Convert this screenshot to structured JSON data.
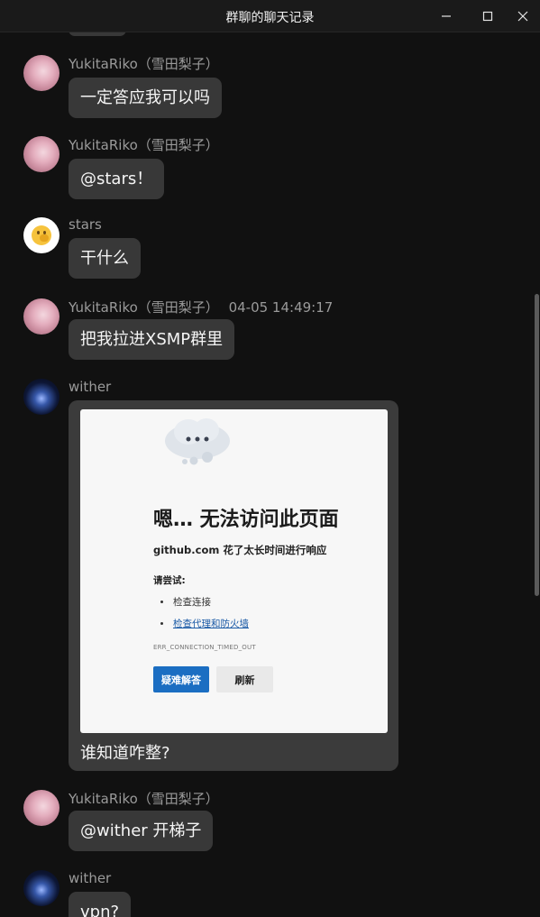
{
  "window": {
    "title": "群聊的聊天记录"
  },
  "messages": [
    {
      "sender": "YukitaRiko（雪田梨子）",
      "text": "一定答应我可以吗",
      "avatar_icon": "anime-girl-avatar"
    },
    {
      "sender": "YukitaRiko（雪田梨子）",
      "text": "@stars！",
      "avatar_icon": "anime-girl-avatar"
    },
    {
      "sender": "stars",
      "text": "干什么",
      "avatar_icon": "thinking-face-emoji"
    },
    {
      "sender": "YukitaRiko（雪田梨子）",
      "time": "04-05 14:49:17",
      "text": "把我拉进XSMP群里",
      "avatar_icon": "anime-girl-avatar"
    },
    {
      "sender": "wither",
      "text": "谁知道咋整?",
      "avatar_icon": "night-sky-avatar"
    },
    {
      "sender": "YukitaRiko（雪田梨子）",
      "text": "@wither 开梯子",
      "avatar_icon": "anime-girl-avatar"
    },
    {
      "sender": "wither",
      "text": "vpn?",
      "avatar_icon": "night-sky-avatar"
    }
  ],
  "error_page": {
    "heading": "嗯… 无法访问此页面",
    "subtitle": "github.com 花了太长时间进行响应",
    "try_label": "请尝试:",
    "suggestions": [
      "检查连接",
      "检查代理和防火墙"
    ],
    "code": "ERR_CONNECTION_TIMED_OUT",
    "primary_button": "疑难解答",
    "secondary_button": "刷新"
  }
}
